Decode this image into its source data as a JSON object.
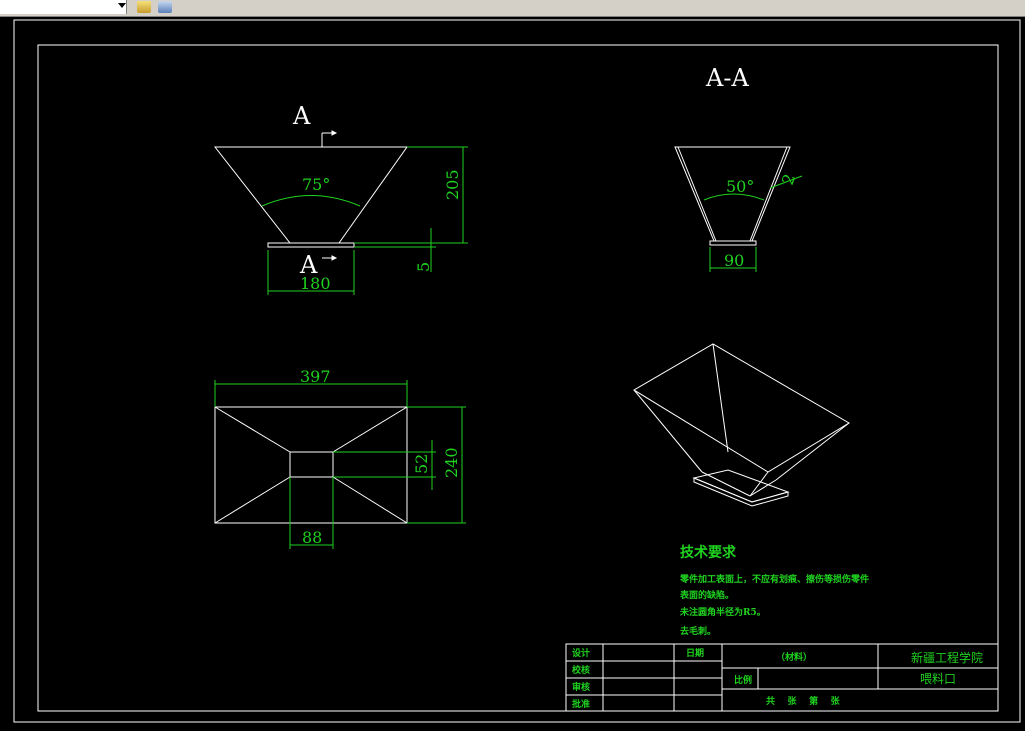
{
  "toolbar": {
    "layer_combo_value": ""
  },
  "drawing": {
    "section_label_top": "A",
    "section_label_bottom": "A",
    "section_title": "A-A",
    "front": {
      "angle": "75°",
      "height": "205",
      "plate_thickness": "5",
      "bottom_width": "180"
    },
    "plan": {
      "width": "397",
      "depth": "240",
      "inner_depth": "52",
      "inner_width": "88"
    },
    "section": {
      "angle": "50°",
      "wall": "2",
      "bottom_width": "90"
    },
    "tech": {
      "title": "技术要求",
      "lines": [
        "零件加工表面上，不应有划痕、擦伤等损伤零件",
        "表面的缺陷。",
        "未注圆角半径为R5。",
        "去毛刺。"
      ]
    },
    "title_block": {
      "design": "设计",
      "check": "校核",
      "review": "审核",
      "approve": "批准",
      "date": "日期",
      "material": "（材料）",
      "scale": "比例",
      "school": "新疆工程学院",
      "part_name": "喂料口",
      "sheets": "共    张    第    张"
    }
  }
}
